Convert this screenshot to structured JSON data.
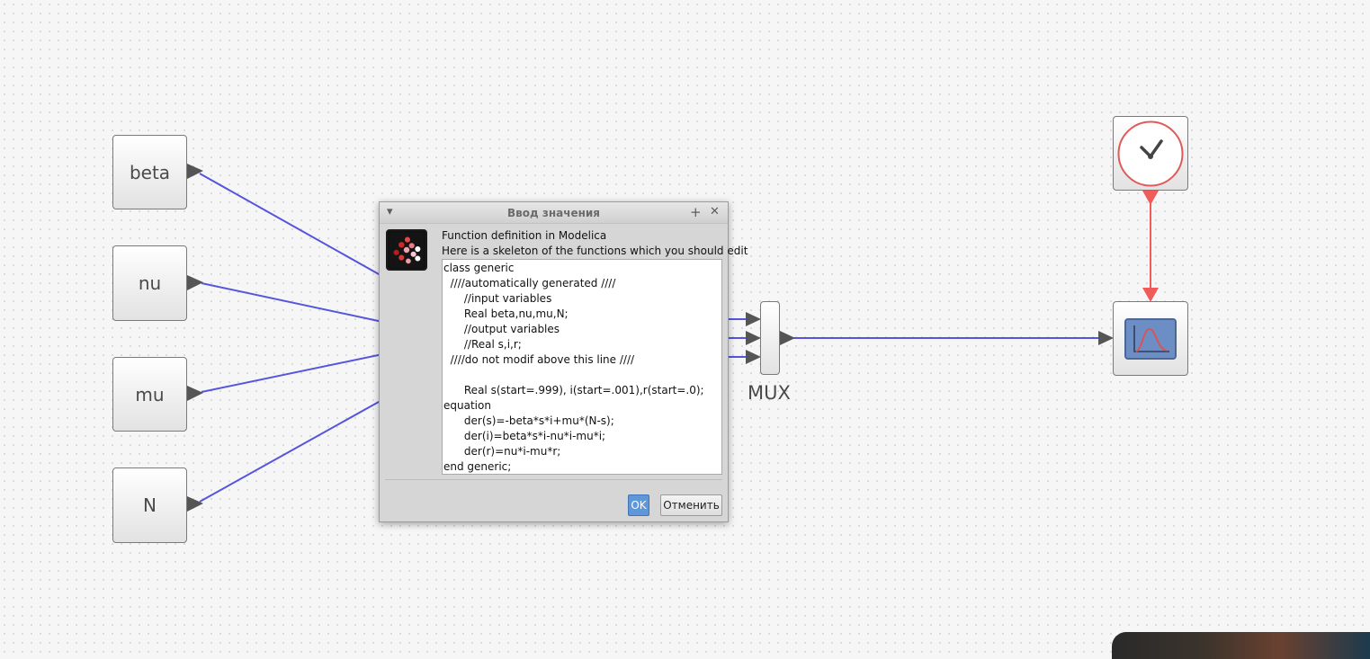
{
  "diagram": {
    "inputs": [
      {
        "label": "beta"
      },
      {
        "label": "nu"
      },
      {
        "label": "mu"
      },
      {
        "label": "N"
      }
    ],
    "mux": {
      "label": "MUX"
    },
    "clock": {
      "icon": "clock-icon",
      "color": "#e05a5a"
    },
    "scope": {
      "icon": "scope-icon",
      "color": "#5b7fb6"
    },
    "link_color": "#5555dd",
    "clock_link_color": "#ef5a5a"
  },
  "dialog": {
    "title": "Ввод значения",
    "heading": "Function definition in Modelica",
    "subheading": "Here is a skeleton of the functions which you should edit",
    "code": "class generic\n  ////automatically generated ////\n      //input variables\n      Real beta,nu,mu,N;\n      //output variables\n      //Real s,i,r;\n  ////do not modif above this line ////\n\n      Real s(start=.999), i(start=.001),r(start=.0);\nequation\n      der(s)=-beta*s*i+mu*(N-s);\n      der(i)=beta*s*i-nu*i-mu*i;\n      der(r)=nu*i-mu*r;\nend generic;",
    "ok_label": "OK",
    "cancel_label": "Отменить",
    "menu_glyph": "▾",
    "pin_glyph": "+",
    "close_glyph": "✕"
  }
}
